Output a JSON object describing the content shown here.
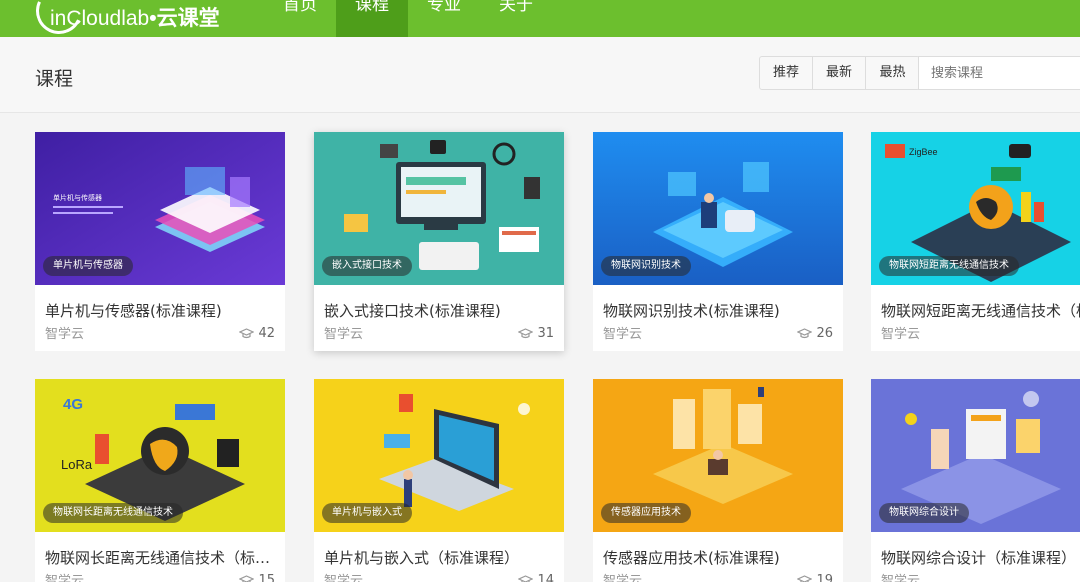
{
  "brand": {
    "logo_text_en": "inCloudlab",
    "logo_text_cn": "•云课堂"
  },
  "nav": [
    {
      "label": "首页",
      "active": false
    },
    {
      "label": "课程",
      "active": true
    },
    {
      "label": "专业",
      "active": false
    },
    {
      "label": "关于",
      "active": false
    }
  ],
  "header": {
    "title": "课程"
  },
  "sort": [
    {
      "label": "推荐"
    },
    {
      "label": "最新"
    },
    {
      "label": "最热"
    }
  ],
  "search": {
    "placeholder": "搜索课程",
    "value": ""
  },
  "courses": [
    {
      "tag": "单片机与传感器",
      "title": "单片机与传感器(标准课程)",
      "author": "智学云",
      "count": "42",
      "bg": "#4b2bb0"
    },
    {
      "tag": "嵌入式接口技术",
      "title": "嵌入式接口技术(标准课程)",
      "author": "智学云",
      "count": "31",
      "bg": "#3fb3a6"
    },
    {
      "tag": "物联网识别技术",
      "title": "物联网识别技术(标准课程)",
      "author": "智学云",
      "count": "26",
      "bg": "#1f7be0"
    },
    {
      "tag": "物联网短距离无线通信技术",
      "title": "物联网短距离无线通信技术（标准课程）",
      "author": "智学云",
      "count": "",
      "bg": "#16d2e6"
    },
    {
      "tag": "物联网长距离无线通信技术",
      "title": "物联网长距离无线通信技术（标准课程）",
      "author": "智学云",
      "count": "15",
      "bg": "#e3df1e"
    },
    {
      "tag": "单片机与嵌入式",
      "title": "单片机与嵌入式（标准课程）",
      "author": "智学云",
      "count": "14",
      "bg": "#f6d21a"
    },
    {
      "tag": "传感器应用技术",
      "title": "传感器应用技术(标准课程)",
      "author": "智学云",
      "count": "19",
      "bg": "#f5a614"
    },
    {
      "tag": "物联网综合设计",
      "title": "物联网综合设计（标准课程）",
      "author": "智学云",
      "count": "",
      "bg": "#6a73d8"
    }
  ],
  "icons": {
    "student_count": "graduation-cap-icon"
  }
}
